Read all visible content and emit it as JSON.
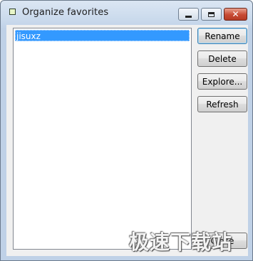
{
  "window": {
    "title": "Organize favorites",
    "minimize_label": "",
    "maximize_label": "",
    "close_label": "✕"
  },
  "list": {
    "items": [
      "jisuxz"
    ],
    "selected_index": 0
  },
  "buttons": {
    "rename": "Rename",
    "delete": "Delete",
    "explore": "Explore...",
    "refresh": "Refresh",
    "close": "Close"
  },
  "watermark": "极速下载站",
  "colors": {
    "selection": "#3399ff",
    "close_button": "#c74a33",
    "dialog_bg": "#f0f0f0"
  }
}
